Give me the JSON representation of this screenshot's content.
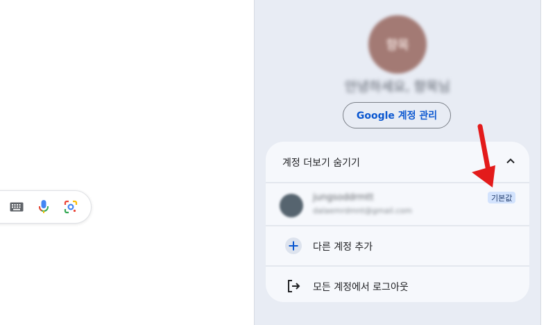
{
  "search_bar": {
    "icons": [
      "keyboard-icon",
      "mic-icon",
      "google-lens-icon"
    ]
  },
  "account_panel": {
    "avatar_text": "향목",
    "greeting": "안녕하세요, 향목님",
    "manage_button": "Google 계정 관리",
    "accounts_section": {
      "toggle_label": "계정 더보기 숨기기",
      "account": {
        "name": "jungsoddrmtt",
        "email": "dalaemrdmnt@gmail.com",
        "badge": "기본값"
      },
      "add_account": "다른 계정 추가",
      "sign_out_all": "모든 계정에서 로그아웃"
    }
  },
  "colors": {
    "accent": "#0b57d0",
    "panel_bg": "#e8ecf4",
    "annotation": "#e31b1b"
  }
}
